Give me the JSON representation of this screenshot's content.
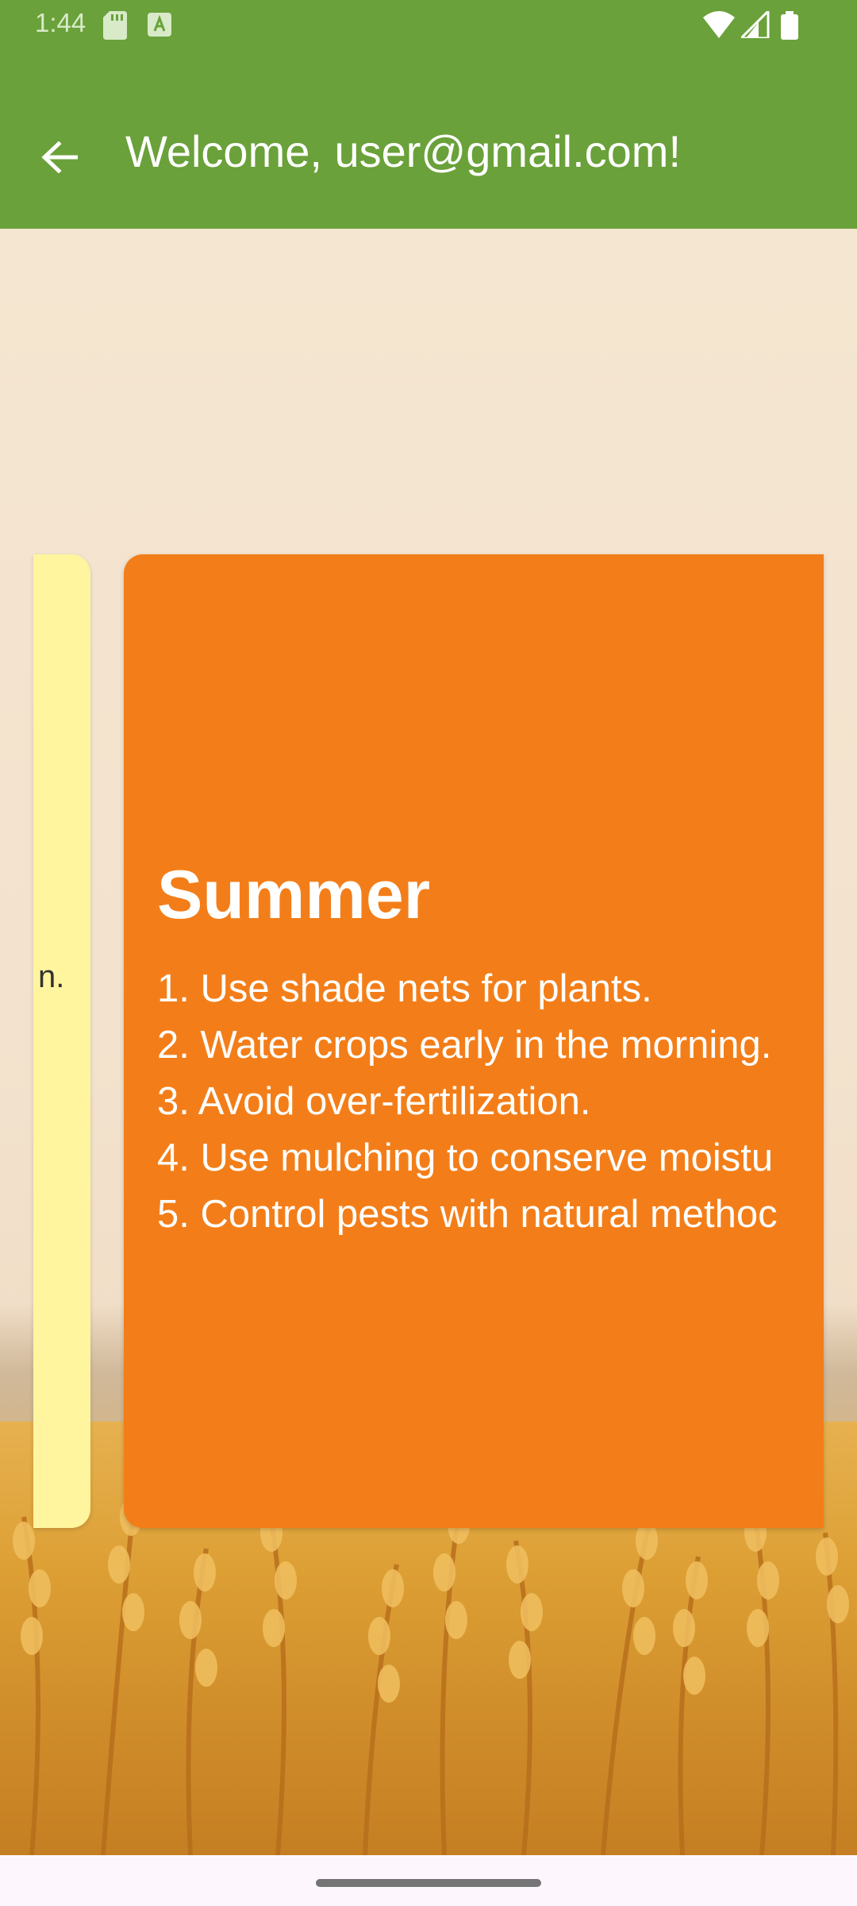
{
  "status_bar": {
    "time": "1:44",
    "icons": [
      "sd-card-icon",
      "a-notification-icon",
      "wifi-icon",
      "signal-icon",
      "battery-icon"
    ]
  },
  "app_bar": {
    "back_icon": "arrow-left-icon",
    "title": "Welcome, user@gmail.com!"
  },
  "carousel": {
    "previous_card": {
      "visible_text": "n.",
      "color": "#fff59e"
    },
    "current_card": {
      "title": "Summer",
      "color": "#f37e19",
      "tips": [
        "1. Use shade nets for plants.",
        "2. Water crops early in the morning.",
        "3. Avoid over-fertilization.",
        "4. Use mulching to conserve moistu",
        "5. Control pests with natural methoc"
      ]
    }
  },
  "colors": {
    "app_bar": "#6aa13a",
    "card_summer": "#f37e19",
    "card_previous": "#fff59e"
  }
}
